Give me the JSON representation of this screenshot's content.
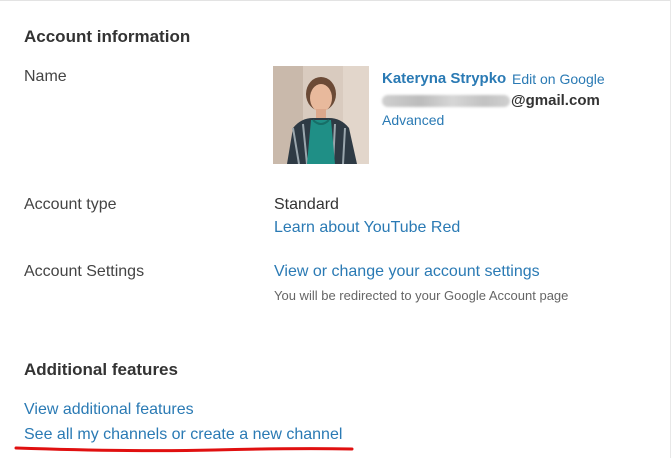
{
  "account_info": {
    "heading": "Account information",
    "name_label": "Name",
    "user_name": "Kateryna Strypko",
    "edit_link": "Edit on Google",
    "email_suffix": "@gmail.com",
    "advanced_link": "Advanced",
    "avatar_icon": "user-avatar-photo",
    "account_type_label": "Account type",
    "account_type_value": "Standard",
    "learn_link": "Learn about YouTube Red",
    "account_settings_label": "Account Settings",
    "settings_link": "View or change your account settings",
    "settings_hint": "You will be redirected to your Google Account page"
  },
  "additional": {
    "heading": "Additional features",
    "view_link": "View additional features",
    "channels_link": "See all my channels or create a new channel"
  },
  "colors": {
    "link": "#2a7ab4",
    "annotation": "#e01010"
  }
}
